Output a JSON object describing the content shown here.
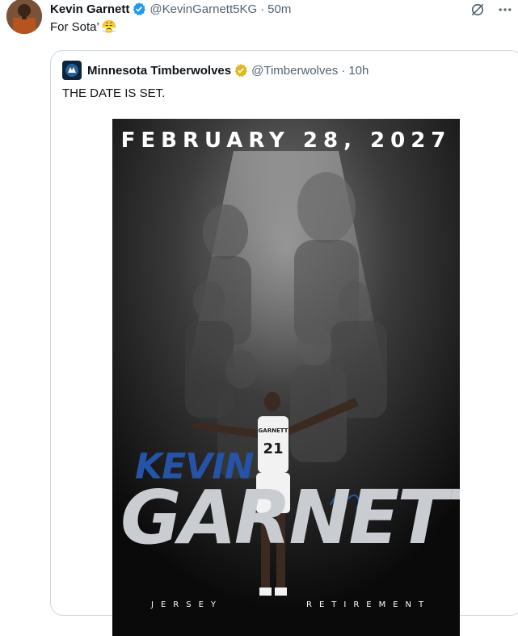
{
  "tweet": {
    "author_name": "Kevin Garnett",
    "author_handle": "@KevinGarnett5KG",
    "separator": "·",
    "time": "50m",
    "text": "For Sota’",
    "emoji": "😤"
  },
  "quoted": {
    "author_name": "Minnesota Timberwolves",
    "author_handle": "@Timberwolves",
    "separator": "·",
    "time": "10h",
    "text": "THE DATE IS SET."
  },
  "poster": {
    "date": "FEBRUARY 28, 2027",
    "first_name": "KEVIN",
    "last_name": "GARNETT",
    "sub_left": "JERSEY",
    "sub_right": "RETIREMENT",
    "jersey_name": "GARNETT",
    "jersey_number": "21"
  },
  "colors": {
    "verified_blue": "#1d9bf0",
    "verified_gold": "#e2b719",
    "kevin_blue": "#2453a8"
  },
  "icons": {
    "grok": "grok-icon",
    "more": "more-icon"
  }
}
